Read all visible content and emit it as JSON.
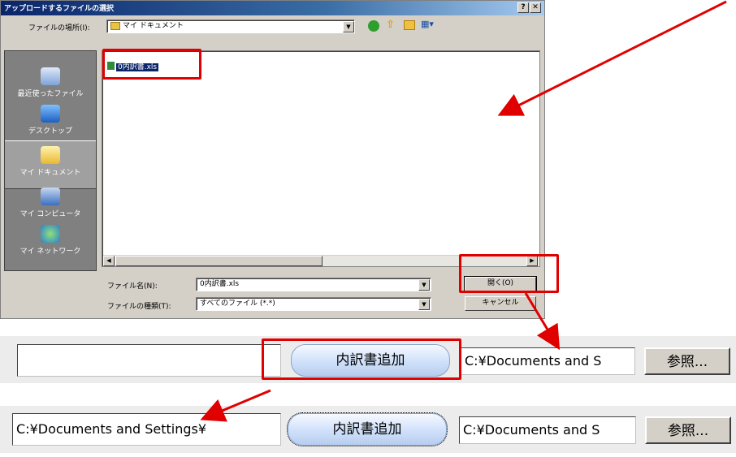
{
  "dialog": {
    "title": "アップロードするファイルの選択",
    "help_btn": "?",
    "close_btn": "✕",
    "lookin_label": "ファイルの場所(I):",
    "lookin_value": "マイ ドキュメント",
    "toolbar": {
      "back": "●",
      "up": "⇧",
      "newfolder": "✱",
      "views": "▦▾"
    },
    "places": [
      {
        "label": "最近使ったファイル",
        "icon": "recent-icon"
      },
      {
        "label": "デスクトップ",
        "icon": "desktop-icon"
      },
      {
        "label": "マイ ドキュメント",
        "icon": "mydocs-icon"
      },
      {
        "label": "マイ コンピュータ",
        "icon": "mycomputer-icon"
      },
      {
        "label": "マイ ネットワーク",
        "icon": "network-icon"
      }
    ],
    "file_item": "0内訳書.xls",
    "filename_label": "ファイル名(N):",
    "filename_value": "0内訳書.xls",
    "filetype_label": "ファイルの種類(T):",
    "filetype_value": "すべてのファイル (*.*)",
    "open_btn": "開く(O)",
    "cancel_btn": "キャンセル",
    "scroll_left": "◀",
    "scroll_right": "▶"
  },
  "row1": {
    "input_value": "",
    "add_btn": "内訳書追加",
    "path_value": "C:¥Documents and S",
    "browse_btn": "参照..."
  },
  "row2": {
    "input_value": "C:¥Documents and Settings¥",
    "add_btn": "内訳書追加",
    "path_value": "C:¥Documents and S",
    "browse_btn": "参照..."
  },
  "colors": {
    "annotation": "#e00000",
    "title_bar": "#0a246a",
    "dialog_bg": "#d4d0c8"
  }
}
